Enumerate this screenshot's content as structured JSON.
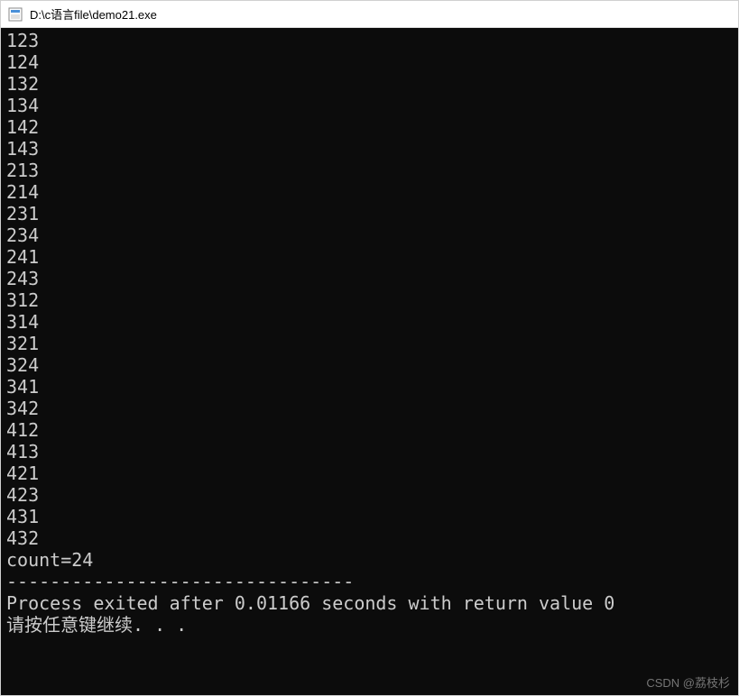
{
  "window": {
    "title": "D:\\c语言file\\demo21.exe"
  },
  "console": {
    "lines": [
      "123",
      "124",
      "132",
      "134",
      "142",
      "143",
      "213",
      "214",
      "231",
      "234",
      "241",
      "243",
      "312",
      "314",
      "321",
      "324",
      "341",
      "342",
      "412",
      "413",
      "421",
      "423",
      "431",
      "432",
      "count=24",
      "",
      "--------------------------------",
      "Process exited after 0.01166 seconds with return value 0",
      "请按任意键继续. . ."
    ]
  },
  "watermark": "CSDN @荔枝杉"
}
